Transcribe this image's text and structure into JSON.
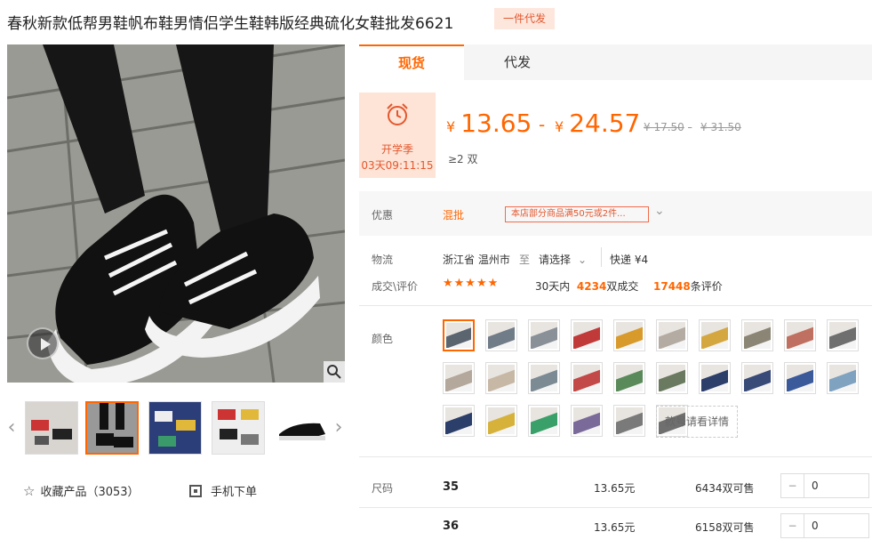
{
  "product": {
    "title": "春秋新款低帮男鞋帆布鞋男情侣学生鞋韩版经典硫化女鞋批发6621",
    "badge": "一件代发"
  },
  "tabs": [
    "现货",
    "代发"
  ],
  "promo": {
    "label": "开学季",
    "countdown": "03天09:11:15",
    "icon": "alarm-clock-icon"
  },
  "price": {
    "currency": "¥",
    "low": "13.65",
    "sep": "-",
    "high": "24.57",
    "old_low": "¥ 17.50",
    "old_sep": "-",
    "old_high": "¥ 31.50",
    "moq": "≥2 双"
  },
  "coupon": {
    "label": "优惠",
    "mix": "混批",
    "text": "本店部分商品满50元或2件...",
    "icon": "chevron-down-icon"
  },
  "logistics": {
    "label": "物流",
    "origin": "浙江省 温州市",
    "to": "至",
    "select": "请选择",
    "express": "快递 ¥4"
  },
  "deals": {
    "label": "成交\\评价",
    "stars": "★★★★★",
    "prefix": "30天内",
    "count": "4234",
    "suffix": "双成交",
    "reviews": "17448",
    "reviews_suffix": "条评价"
  },
  "color_label": "颜色",
  "color_more": "款号请看详情",
  "swatches": [
    "#5a6570",
    "#707c88",
    "#8a9098",
    "#c13a3a",
    "#d89a2a",
    "#b4aca3",
    "#d4a740",
    "#8a8574",
    "#c07060",
    "#6f6f6f",
    "#b3a89b",
    "#c7b8a6",
    "#7c8a94",
    "#c34848",
    "#5a8a5a",
    "#6a7a60",
    "#2c3e6a",
    "#384a78",
    "#3a5a9a",
    "#7fa2c0",
    "#2c3e6a",
    "#d6b23a",
    "#3aa06a",
    "#7a6a9a",
    "#7a7a7a",
    "#6f6f6f"
  ],
  "sizes": [
    {
      "label": "尺码",
      "size": "35",
      "price": "13.65元",
      "stock": "6434双可售",
      "qty": "0"
    },
    {
      "label": "",
      "size": "36",
      "price": "13.65元",
      "stock": "6158双可售",
      "qty": "0"
    }
  ],
  "favorite": {
    "icon": "star-outline-icon",
    "text": "收藏产品（3053）"
  },
  "mobile": {
    "icon": "qrcode-icon",
    "text": "手机下单"
  },
  "nav": {
    "prev": "‹",
    "next": "›"
  },
  "zoom_icon": "magnifier-icon",
  "play_icon": "play-icon"
}
